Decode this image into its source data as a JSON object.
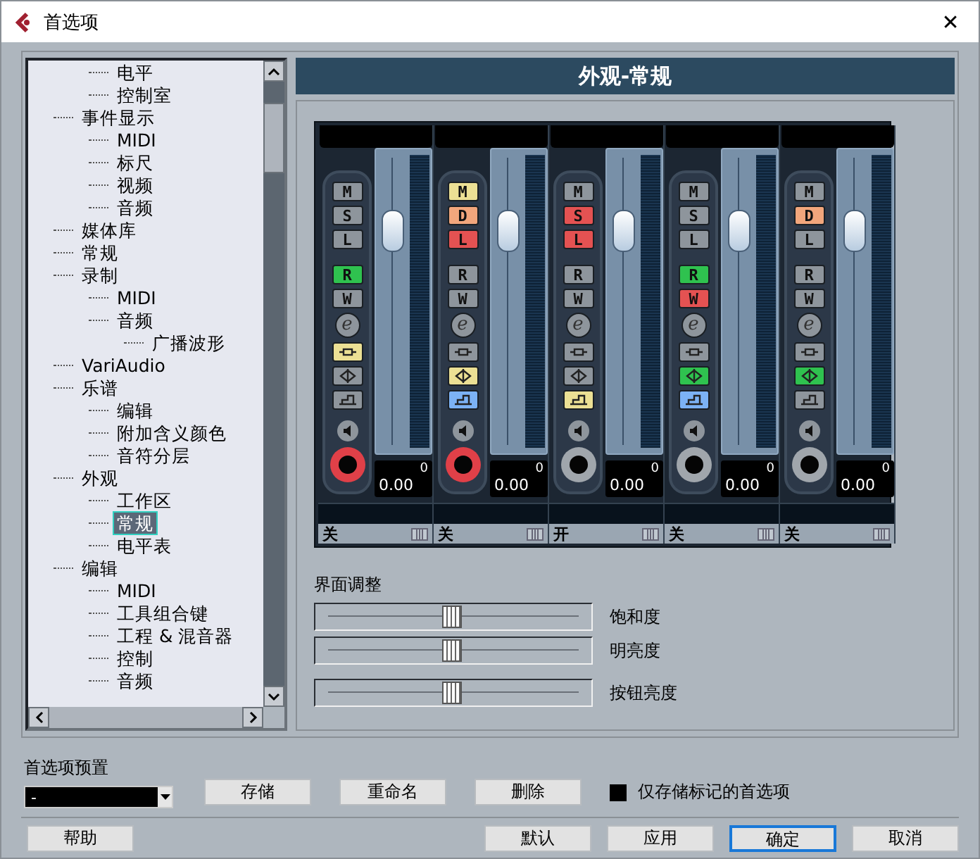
{
  "window": {
    "title": "首选项",
    "close": "✕"
  },
  "tree": {
    "items": [
      {
        "children": [
          {
            "label": "电平",
            "selected": false
          },
          {
            "label": "控制室",
            "selected": false
          }
        ]
      },
      {
        "label": "事件显示",
        "selected": false,
        "children": [
          {
            "label": "MIDI",
            "selected": false
          },
          {
            "label": "标尺",
            "selected": false
          },
          {
            "label": "视频",
            "selected": false
          },
          {
            "label": "音频",
            "selected": false
          }
        ]
      },
      {
        "label": "媒体库",
        "selected": false
      },
      {
        "label": "常规",
        "selected": false
      },
      {
        "label": "录制",
        "selected": false,
        "children": [
          {
            "label": "MIDI",
            "selected": false
          },
          {
            "label": "音频",
            "selected": false,
            "children": [
              {
                "label": "广播波形",
                "selected": false
              }
            ]
          }
        ]
      },
      {
        "label": "VariAudio",
        "selected": false
      },
      {
        "label": "乐谱",
        "selected": false,
        "children": [
          {
            "label": "编辑",
            "selected": false
          },
          {
            "label": "附加含义颜色",
            "selected": false
          },
          {
            "label": "音符分层",
            "selected": false
          }
        ]
      },
      {
        "label": "外观",
        "selected": false,
        "children": [
          {
            "label": "工作区",
            "selected": false
          },
          {
            "label": "常规",
            "selected": true
          },
          {
            "label": "电平表",
            "selected": false
          }
        ]
      },
      {
        "label": "编辑",
        "selected": false,
        "children": [
          {
            "label": "MIDI",
            "selected": false
          },
          {
            "label": "工具组合键",
            "selected": false
          },
          {
            "label": "工程 & 混音器",
            "selected": false
          },
          {
            "label": "控制",
            "selected": false
          },
          {
            "label": "音频",
            "selected": false
          }
        ]
      }
    ]
  },
  "panel": {
    "title": "外观-常规"
  },
  "channels": [
    {
      "buttons": [
        {
          "label": "M",
          "color": "#8e959c"
        },
        {
          "label": "S",
          "color": "#8e959c"
        },
        {
          "label": "L",
          "color": "#8e959c"
        },
        {
          "label": "R",
          "color": "#2fc24f"
        },
        {
          "label": "W",
          "color": "#8e959c"
        }
      ],
      "edit": "e",
      "tools": [
        {
          "kind": "insert",
          "color": "#ece094"
        },
        {
          "kind": "pan",
          "color": "#8e959c"
        },
        {
          "kind": "send",
          "color": "#8e959c"
        }
      ],
      "armed": true,
      "level": 0.78,
      "value": "0.00",
      "peak": "0",
      "label": "关"
    },
    {
      "buttons": [
        {
          "label": "M",
          "color": "#ece094"
        },
        {
          "label": "D",
          "color": "#f2a67c"
        },
        {
          "label": "L",
          "color": "#e45252"
        },
        {
          "label": "R",
          "color": "#8e959c"
        },
        {
          "label": "W",
          "color": "#8e959c"
        }
      ],
      "edit": "e",
      "tools": [
        {
          "kind": "insert",
          "color": "#8e959c"
        },
        {
          "kind": "pan",
          "color": "#ece094"
        },
        {
          "kind": "send",
          "color": "#7cb2f4"
        }
      ],
      "armed": true,
      "level": 0.78,
      "value": "0.00",
      "peak": "0",
      "label": "关"
    },
    {
      "buttons": [
        {
          "label": "M",
          "color": "#8e959c"
        },
        {
          "label": "S",
          "color": "#e45252"
        },
        {
          "label": "L",
          "color": "#e45252"
        },
        {
          "label": "R",
          "color": "#8e959c"
        },
        {
          "label": "W",
          "color": "#8e959c"
        }
      ],
      "edit": "e",
      "tools": [
        {
          "kind": "insert",
          "color": "#8e959c"
        },
        {
          "kind": "pan",
          "color": "#8e959c"
        },
        {
          "kind": "send",
          "color": "#ece094"
        }
      ],
      "armed": false,
      "level": 0.78,
      "value": "0.00",
      "peak": "0",
      "label": "开"
    },
    {
      "buttons": [
        {
          "label": "M",
          "color": "#8e959c"
        },
        {
          "label": "S",
          "color": "#8e959c"
        },
        {
          "label": "L",
          "color": "#8e959c"
        },
        {
          "label": "R",
          "color": "#2fc24f"
        },
        {
          "label": "W",
          "color": "#e45252"
        }
      ],
      "edit": "e",
      "tools": [
        {
          "kind": "insert",
          "color": "#8e959c"
        },
        {
          "kind": "pan",
          "color": "#2fc24f"
        },
        {
          "kind": "send",
          "color": "#7cb2f4"
        }
      ],
      "armed": false,
      "level": 0.78,
      "value": "0.00",
      "peak": "0",
      "label": "关"
    },
    {
      "buttons": [
        {
          "label": "M",
          "color": "#8e959c"
        },
        {
          "label": "D",
          "color": "#f2a67c"
        },
        {
          "label": "L",
          "color": "#8e959c"
        },
        {
          "label": "R",
          "color": "#8e959c"
        },
        {
          "label": "W",
          "color": "#8e959c"
        }
      ],
      "edit": "e",
      "tools": [
        {
          "kind": "insert",
          "color": "#8e959c"
        },
        {
          "kind": "pan",
          "color": "#2fc24f"
        },
        {
          "kind": "send",
          "color": "#8e959c"
        }
      ],
      "armed": false,
      "level": 0.78,
      "value": "0.00",
      "peak": "0",
      "label": "关"
    }
  ],
  "adjust": {
    "title": "界面调整",
    "sliders": [
      {
        "label": "饱和度",
        "level": 0.5
      },
      {
        "label": "明亮度",
        "level": 0.5
      },
      {
        "label": "按钮亮度",
        "level": 0.5
      }
    ]
  },
  "preset": {
    "label": "首选项预置",
    "value": "-",
    "buttons": [
      "存储",
      "重命名",
      "删除"
    ],
    "checkbox": {
      "label": "仅存储标记的首选项",
      "checked": false
    }
  },
  "footer": [
    {
      "label": "帮助",
      "selected": false
    },
    {
      "label": "默认",
      "selected": false
    },
    {
      "label": "应用",
      "selected": false
    },
    {
      "label": "确定",
      "selected": true
    },
    {
      "label": "取消",
      "selected": false
    }
  ]
}
